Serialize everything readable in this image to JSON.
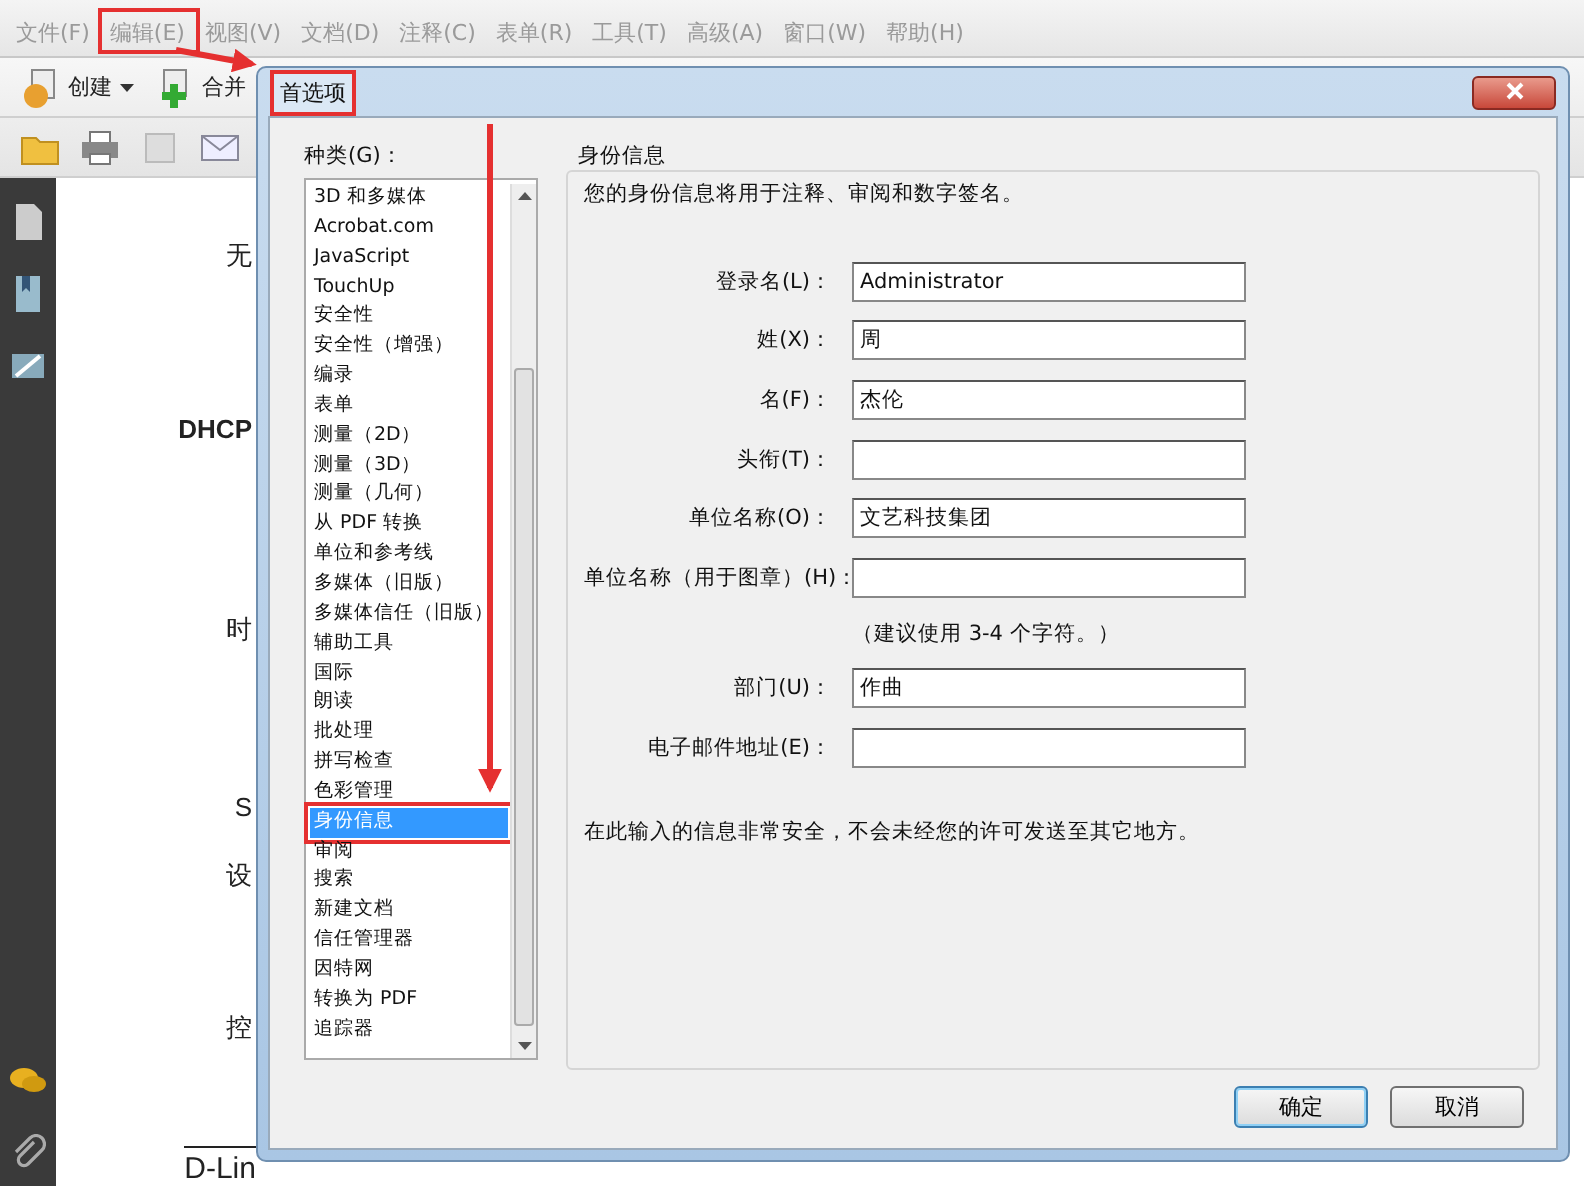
{
  "menu": [
    {
      "label": "文件(F)",
      "highlighted": false
    },
    {
      "label": "编辑(E)",
      "highlighted": true
    },
    {
      "label": "视图(V)",
      "highlighted": false
    },
    {
      "label": "文档(D)",
      "highlighted": false
    },
    {
      "label": "注释(C)",
      "highlighted": false
    },
    {
      "label": "表单(R)",
      "highlighted": false
    },
    {
      "label": "工具(T)",
      "highlighted": false
    },
    {
      "label": "高级(A)",
      "highlighted": false
    },
    {
      "label": "窗口(W)",
      "highlighted": false
    },
    {
      "label": "帮助(H)",
      "highlighted": false
    }
  ],
  "toolbar": [
    {
      "label": "创建",
      "dropdown": true
    },
    {
      "label": "合并",
      "dropdown": false
    }
  ],
  "document": {
    "texts": [
      {
        "text": "无"
      },
      {
        "text": "DHCP"
      },
      {
        "text": "时"
      },
      {
        "text": "S"
      },
      {
        "text": "设"
      },
      {
        "text": "控"
      },
      {
        "text": "D-Lin"
      }
    ]
  },
  "dialog": {
    "title": "首选项",
    "title_highlighted": true,
    "category_label": "种类(G)：",
    "categories": [
      {
        "label": "3D 和多媒体",
        "selected": false
      },
      {
        "label": "Acrobat.com",
        "selected": false
      },
      {
        "label": "JavaScript",
        "selected": false
      },
      {
        "label": "TouchUp",
        "selected": false
      },
      {
        "label": "安全性",
        "selected": false
      },
      {
        "label": "安全性（增强）",
        "selected": false
      },
      {
        "label": "编录",
        "selected": false
      },
      {
        "label": "表单",
        "selected": false
      },
      {
        "label": "测量（2D）",
        "selected": false
      },
      {
        "label": "测量（3D）",
        "selected": false
      },
      {
        "label": "测量（几何）",
        "selected": false
      },
      {
        "label": "从 PDF 转换",
        "selected": false
      },
      {
        "label": "单位和参考线",
        "selected": false
      },
      {
        "label": "多媒体（旧版）",
        "selected": false
      },
      {
        "label": "多媒体信任（旧版）",
        "selected": false
      },
      {
        "label": "辅助工具",
        "selected": false
      },
      {
        "label": "国际",
        "selected": false
      },
      {
        "label": "朗读",
        "selected": false
      },
      {
        "label": "批处理",
        "selected": false
      },
      {
        "label": "拼写检查",
        "selected": false
      },
      {
        "label": "色彩管理",
        "selected": false
      },
      {
        "label": "身份信息",
        "selected": true
      },
      {
        "label": "审阅",
        "selected": false
      },
      {
        "label": "搜索",
        "selected": false
      },
      {
        "label": "新建文档",
        "selected": false
      },
      {
        "label": "信任管理器",
        "selected": false
      },
      {
        "label": "因特网",
        "selected": false
      },
      {
        "label": "转换为 PDF",
        "selected": false
      },
      {
        "label": "追踪器",
        "selected": false
      }
    ],
    "section_title": "身份信息",
    "description": "您的身份信息将用于注释、审阅和数字签名。",
    "fields": [
      {
        "kind": "input",
        "label": "登录名(L)：",
        "value": "Administrator"
      },
      {
        "kind": "input",
        "label": "姓(X)：",
        "value": "周"
      },
      {
        "kind": "input",
        "label": "名(F)：",
        "value": "杰伦"
      },
      {
        "kind": "input",
        "label": "头衔(T)："
      },
      {
        "kind": "input",
        "label": "单位名称(O)：",
        "value": "文艺科技集团"
      },
      {
        "kind": "input",
        "label": "单位名称（用于图章）(H)："
      },
      {
        "kind": "hint",
        "label": "（建议使用 3-4 个字符。）"
      },
      {
        "kind": "input",
        "label": "部门(U)：",
        "value": "作曲"
      },
      {
        "kind": "input",
        "label": "电子邮件地址(E)："
      }
    ],
    "note": "在此输入的信息非常安全，不会未经您的许可发送至其它地方。",
    "buttons": [
      {
        "label": "确定",
        "default": true
      },
      {
        "label": "取消",
        "default": false
      }
    ]
  }
}
